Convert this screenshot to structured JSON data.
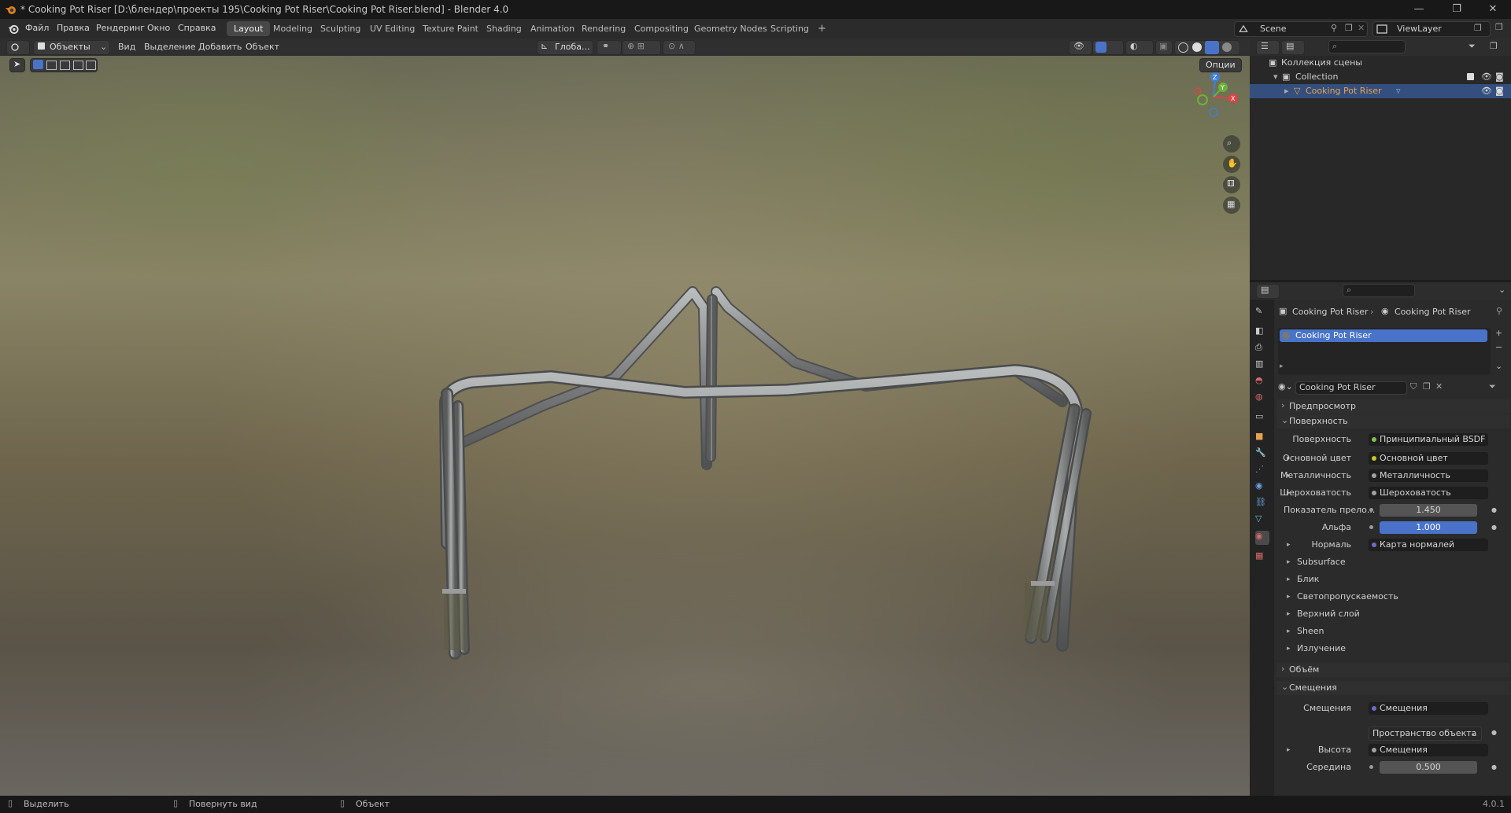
{
  "window": {
    "title": "* Cooking Pot Riser [D:\\блендер\\проекты 195\\Cooking Pot Riser\\Cooking Pot Riser.blend] - Blender 4.0",
    "minimize": "—",
    "maximize": "❐",
    "close": "✕"
  },
  "menu": [
    "Файл",
    "Правка",
    "Рендеринг",
    "Окно",
    "Справка"
  ],
  "workspaces": [
    "Layout",
    "Modeling",
    "Sculpting",
    "UV Editing",
    "Texture Paint",
    "Shading",
    "Animation",
    "Rendering",
    "Compositing",
    "Geometry Nodes",
    "Scripting"
  ],
  "active_workspace": "Layout",
  "add_workspace": "+",
  "scene": {
    "name": "Scene",
    "view_layer": "ViewLayer"
  },
  "viewport_header": {
    "mode": "Объекты",
    "menus": [
      "Вид",
      "Выделение",
      "Добавить",
      "Объект"
    ],
    "orientation": "Глоба...",
    "options": "Опции"
  },
  "gizmo": {
    "z": "Z",
    "y": "Y",
    "x": "X"
  },
  "outliner": {
    "root": "Коллекция сцены",
    "collection": "Collection",
    "object": "Cooking Pot Riser"
  },
  "properties": {
    "breadcrumb_object": "Cooking Pot Riser",
    "breadcrumb_material": "Cooking Pot Riser",
    "slot": "Cooking Pot Riser",
    "material_name": "Cooking Pot Riser",
    "panels": {
      "preview": "Предпросмотр",
      "surface": "Поверхность",
      "volume": "Объём",
      "displacement": "Смещения"
    },
    "surface_rows": [
      {
        "label": "Поверхность",
        "value": "Принципиальный BSDF",
        "dot": "#7fc04b",
        "expand": false
      },
      {
        "label": "Основной цвет",
        "value": "Основной цвет",
        "dot": "#c7c729",
        "expand": true
      },
      {
        "label": "Металличность",
        "value": "Металличность",
        "dot": "#a1a1a1",
        "expand": true
      },
      {
        "label": "Шероховатость",
        "value": "Шероховатость",
        "dot": "#a1a1a1",
        "expand": true
      }
    ],
    "ior": {
      "label": "Показатель прело...",
      "value": "1.450"
    },
    "alpha": {
      "label": "Альфа",
      "value": "1.000"
    },
    "normal": {
      "label": "Нормаль",
      "value": "Карта нормалей"
    },
    "subpanels": [
      "Subsurface",
      "Блик",
      "Светопропускаемость",
      "Верхний слой",
      "Sheen",
      "Излучение"
    ],
    "displacement": {
      "label": "Смещения",
      "value": "Смещения",
      "space": "Пространство объекта",
      "height_label": "Высота",
      "height_value": "Смещения",
      "mid_label": "Середина",
      "mid_value": "0.500"
    }
  },
  "status": {
    "select": "Выделить",
    "rotate": "Повернуть вид",
    "object": "Объект",
    "version": "4.0.1"
  },
  "colors": {
    "accent": "#4873c9",
    "selection": "#344f7e",
    "object_orange": "#e8a24b"
  }
}
